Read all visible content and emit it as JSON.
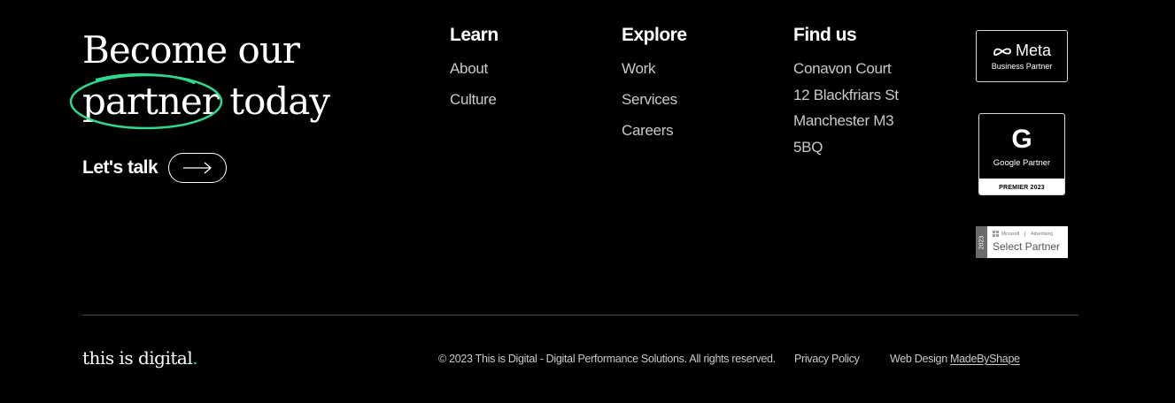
{
  "hero": {
    "line1": "Become our",
    "highlight": "partner",
    "line2_rest": " today",
    "accent_color": "#2fd88f"
  },
  "cta": {
    "label": "Let's talk",
    "icon": "arrow-right-icon"
  },
  "columns": {
    "learn": {
      "heading": "Learn",
      "links": [
        "About",
        "Culture"
      ]
    },
    "explore": {
      "heading": "Explore",
      "links": [
        "Work",
        "Services",
        "Careers"
      ]
    },
    "find_us": {
      "heading": "Find us",
      "address": [
        "Conavon Court",
        "12 Blackfriars St",
        "Manchester M3",
        "5BQ"
      ]
    }
  },
  "badges": {
    "meta": {
      "brand": "Meta",
      "subtitle": "Business Partner"
    },
    "google": {
      "letter": "G",
      "label": "Google Partner",
      "tier": "PREMIER 2023"
    },
    "microsoft": {
      "year": "2023",
      "brand": "Microsoft",
      "product": "Advertising",
      "name": "Select Partner"
    }
  },
  "footer": {
    "brand": "this is digital",
    "brand_dot": ".",
    "copyright": "© 2023 This is Digital - Digital Performance Solutions. All rights reserved.",
    "privacy": "Privacy Policy",
    "web_design_prefix": "Web Design ",
    "web_design_link": "MadeByShape"
  }
}
